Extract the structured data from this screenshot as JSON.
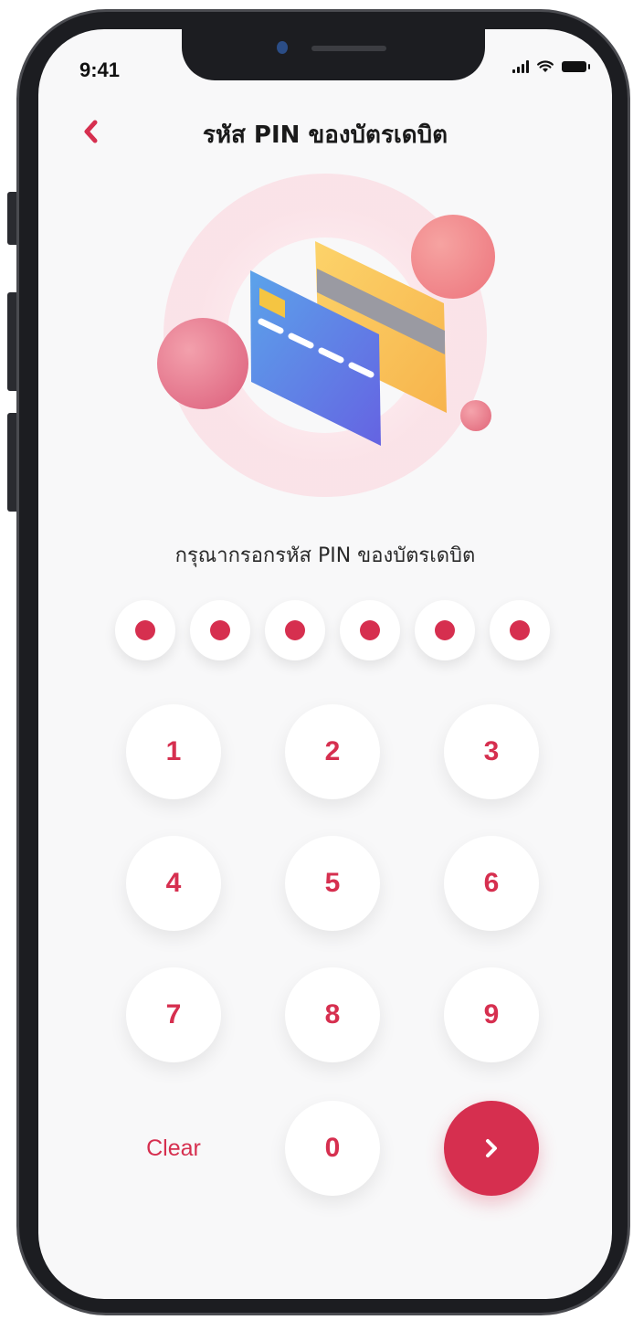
{
  "status_bar": {
    "time": "9:41"
  },
  "header": {
    "title": "รหัส PIN ของบัตรเดบิต",
    "back_icon": "chevron-left-icon"
  },
  "prompt": {
    "text": "กรุณากรอกรหัส PIN ของบัตรเดบิต"
  },
  "pin": {
    "length": 6,
    "filled": 6
  },
  "keypad": {
    "keys": [
      "1",
      "2",
      "3",
      "4",
      "5",
      "6",
      "7",
      "8",
      "9"
    ],
    "zero": "0",
    "clear_label": "Clear",
    "next_icon": "chevron-right-icon"
  },
  "colors": {
    "accent": "#d62f4f",
    "background": "#f8f8f9"
  }
}
